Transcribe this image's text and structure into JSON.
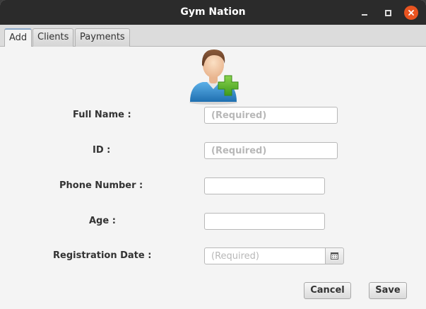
{
  "window": {
    "title": "Gym Nation"
  },
  "tabs": [
    {
      "label": "Add"
    },
    {
      "label": "Clients"
    },
    {
      "label": "Payments"
    }
  ],
  "form": {
    "full_name": {
      "label": "Full Name :",
      "value": "",
      "placeholder": "(Required)"
    },
    "id": {
      "label": "ID :",
      "value": "",
      "placeholder": "(Required)"
    },
    "phone": {
      "label": "Phone Number :",
      "value": "",
      "placeholder": ""
    },
    "age": {
      "label": "Age :",
      "value": "",
      "placeholder": ""
    },
    "registration_date": {
      "label": "Registration Date :",
      "value": "",
      "placeholder": "(Required)"
    }
  },
  "buttons": {
    "cancel": "Cancel",
    "save": "Save"
  },
  "icons": {
    "avatar": "add-user-icon",
    "calendar": "calendar-icon",
    "minimize": "minimize-icon",
    "maximize": "maximize-icon",
    "close": "close-icon"
  },
  "colors": {
    "titlebar": "#2b2b2b",
    "close_button": "#e95420",
    "plus_green": "#5cb82e",
    "avatar_shirt": "#3a8fd0"
  }
}
